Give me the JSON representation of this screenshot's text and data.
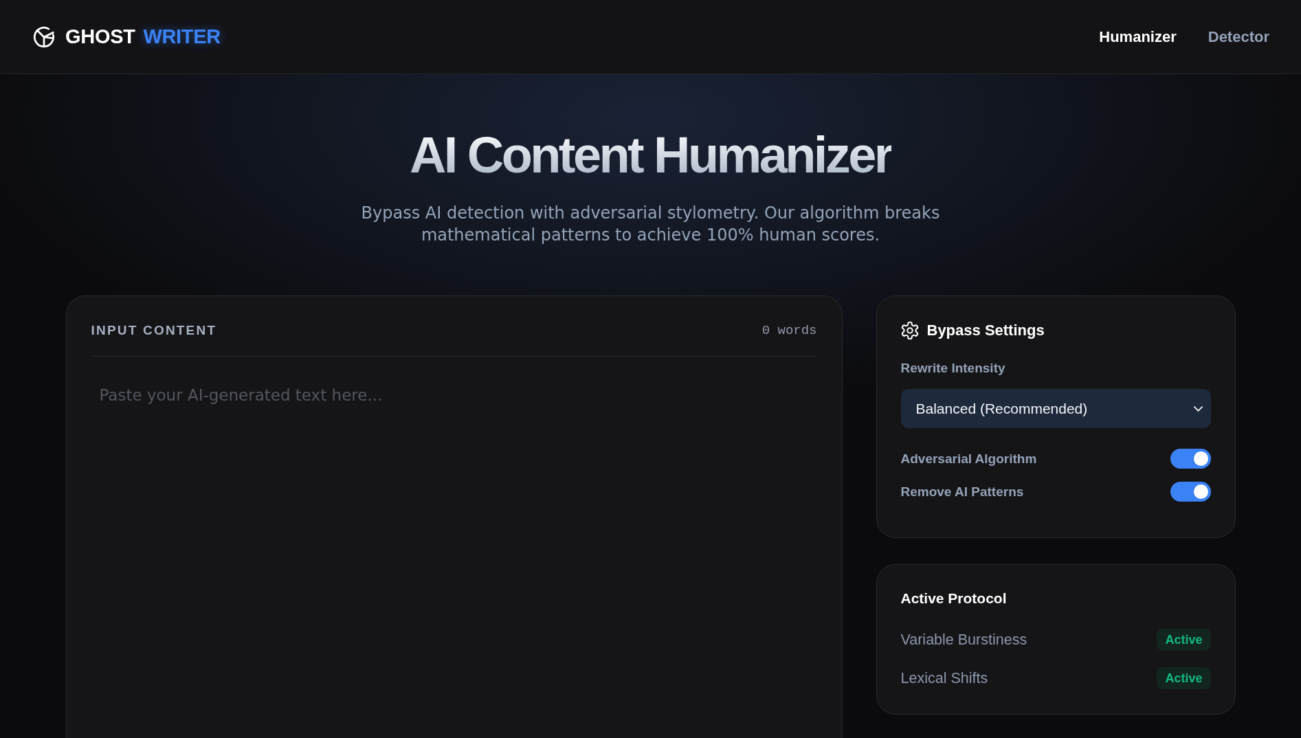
{
  "header": {
    "logo": {
      "name": "GHOST",
      "accent": "WRITER"
    },
    "nav": [
      {
        "label": "Humanizer",
        "selected": true
      },
      {
        "label": "Detector",
        "selected": false
      }
    ]
  },
  "hero": {
    "title": "AI Content Humanizer",
    "subtitle": "Bypass AI detection with adversarial stylometry. Our algorithm breaks mathematical patterns to achieve 100% human scores."
  },
  "input_panel": {
    "title": "INPUT CONTENT",
    "word_count": "0 words",
    "editor": {
      "placeholder": "Paste your AI-generated text here..."
    }
  },
  "settings": {
    "title": "Bypass Settings",
    "intensity": {
      "label": "Rewrite Intensity",
      "value": "Balanced (Recommended)"
    },
    "toggles": [
      {
        "label": "Adversarial Algorithm",
        "on": true
      },
      {
        "label": "Remove AI Patterns",
        "on": true
      }
    ]
  },
  "protocol": {
    "title": "Active Protocol",
    "items": [
      {
        "label": "Variable Burstiness",
        "status": "Active"
      },
      {
        "label": "Lexical Shifts",
        "status": "Active"
      }
    ]
  }
}
